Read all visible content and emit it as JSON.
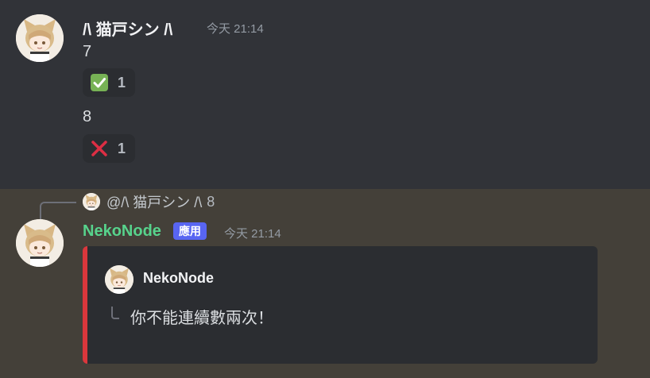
{
  "message1": {
    "username": "/\\ 猫戸シン /\\",
    "timestamp": "今天 21:14",
    "lines": [
      {
        "text": "7",
        "reaction": {
          "emoji": "check-mark-icon",
          "count": "1"
        }
      },
      {
        "text": "8",
        "reaction": {
          "emoji": "cross-mark-icon",
          "count": "1"
        }
      }
    ]
  },
  "message2": {
    "reply": {
      "mention": "@/\\ 猫戸シン /\\",
      "text": "8"
    },
    "username": "NekoNode",
    "badge": "應用",
    "timestamp": "今天 21:14",
    "embed": {
      "author": "NekoNode",
      "description": "你不能連續數兩次！",
      "accent_color": "#da373c"
    }
  },
  "colors": {
    "username_bot": "#57d38c",
    "badge_bg": "#5865f2",
    "reply_highlight_bg": "#444039"
  }
}
